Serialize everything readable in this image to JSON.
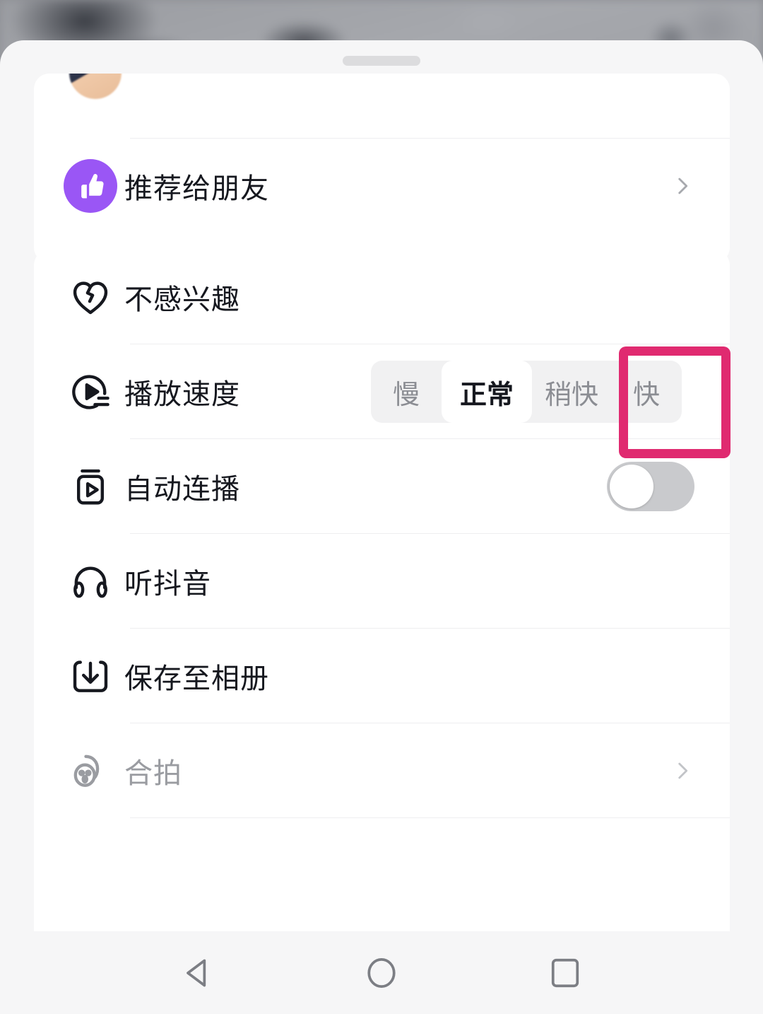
{
  "screen": {
    "app": "douyin",
    "background": "blurred-video-frame",
    "sheet_handle": "drag-handle"
  },
  "colors": {
    "sheet_bg": "#f6f6f7",
    "card_bg": "#ffffff",
    "text_primary": "#16181f",
    "text_disabled": "#9a9ca1",
    "accent_purple": "#9a56f5",
    "annotation_pink": "#e02a70",
    "toggle_off": "#c9cacd",
    "segment_track": "#f1f1f2"
  },
  "card_top": {
    "partial_row": {
      "icon": "avatar"
    },
    "items": [
      {
        "label": "推荐给朋友",
        "icon": "thumbs-up-icon",
        "accessory": "chevron-right-icon"
      }
    ]
  },
  "card_main": {
    "items": [
      {
        "label": "不感兴趣",
        "icon": "broken-heart-icon",
        "accessory": "none"
      },
      {
        "label": "播放速度",
        "icon": "playback-speed-icon",
        "accessory": "segmented-control"
      },
      {
        "label": "自动连播",
        "icon": "autoplay-icon",
        "accessory": "toggle"
      },
      {
        "label": "听抖音",
        "icon": "headphones-icon",
        "accessory": "none"
      },
      {
        "label": "保存至相册",
        "icon": "download-icon",
        "accessory": "none"
      },
      {
        "label": "合拍",
        "icon": "duet-face-icon",
        "accessory": "chevron-right-icon",
        "disabled": true
      }
    ]
  },
  "speed_control": {
    "options": [
      {
        "label": "慢",
        "selected": false
      },
      {
        "label": "正常",
        "selected": true
      },
      {
        "label": "稍快",
        "selected": false
      },
      {
        "label": "快",
        "selected": false
      }
    ],
    "selected_value": "正常",
    "highlighted_option": "快"
  },
  "autoplay_toggle": {
    "state": "off"
  },
  "annotation": {
    "target": "快",
    "shape": "rectangle",
    "color": "#e02a70"
  },
  "navbar": {
    "buttons": [
      {
        "name": "back",
        "icon": "triangle-left-icon"
      },
      {
        "name": "home",
        "icon": "circle-icon"
      },
      {
        "name": "recents",
        "icon": "square-icon"
      }
    ]
  }
}
